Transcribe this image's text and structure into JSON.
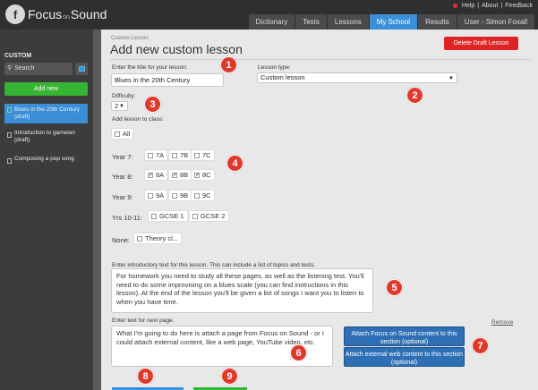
{
  "header": {
    "logo_mark": "f",
    "logo_name_left": "Focus",
    "logo_name_mid": "on",
    "logo_name_right": "Sound",
    "links": [
      "Help",
      "About",
      "Feedback"
    ],
    "tabs": [
      {
        "label": "Dictionary",
        "active": false
      },
      {
        "label": "Tests",
        "active": false
      },
      {
        "label": "Lessons",
        "active": false
      },
      {
        "label": "My School",
        "active": true
      },
      {
        "label": "Results",
        "active": false
      },
      {
        "label": "User - Simon Foxall",
        "active": false
      }
    ]
  },
  "sidebar": {
    "title": "CUSTOM",
    "search_label": "Search",
    "add_label": "Add new",
    "items": [
      {
        "label": "Blues in the 20th Century (draft)",
        "active": true
      },
      {
        "label": "Introduction to gamelan (draft)",
        "active": false
      },
      {
        "label": "Composing a pop song",
        "active": false
      }
    ]
  },
  "main": {
    "breadcrumb": "Custom Lesson",
    "title": "Add new custom lesson",
    "delete_label": "Delete Draft Lesson",
    "title_field_label": "Enter the title for your lesson:",
    "title_value": "Blues in the 20th Century",
    "lesson_type_label": "Lesson type:",
    "lesson_type_value": "Custom lesson",
    "difficulty_label": "Difficulty:",
    "difficulty_value": "2",
    "add_class_label": "Add lesson to class:",
    "all_label": "All",
    "year_rows": [
      {
        "label": "Year 7:",
        "classes": [
          {
            "name": "7A",
            "checked": false
          },
          {
            "name": "7B",
            "checked": false
          },
          {
            "name": "7C",
            "checked": false
          }
        ]
      },
      {
        "label": "Year 8:",
        "classes": [
          {
            "name": "8A",
            "checked": true
          },
          {
            "name": "8B",
            "checked": true
          },
          {
            "name": "8C",
            "checked": true
          }
        ]
      },
      {
        "label": "Year 9:",
        "classes": [
          {
            "name": "9A",
            "checked": false
          },
          {
            "name": "9B",
            "checked": false
          },
          {
            "name": "9C",
            "checked": false
          }
        ]
      },
      {
        "label": "Yrs 10-11:",
        "classes": [
          {
            "name": "GCSE 1",
            "checked": false
          },
          {
            "name": "GCSE 2",
            "checked": false
          }
        ]
      },
      {
        "label": "None:",
        "classes": [
          {
            "name": "Theory cl...",
            "checked": false
          }
        ]
      }
    ],
    "intro_label": "Enter introductory text for this lesson. This can include a list of topics and tests.",
    "intro_text": "For homework you need to study all these pages, as well as the listening test. You'll need to do some improvising on a blues scale (you can find instructions in this lesson). At the end of the lesson you'll be given a list of songs I want you to listen to when you have time.",
    "next_page_label": "Enter text for next page.",
    "remove_label": "Remove",
    "next_page_text": "What I'm going to do here is attach a page from Focus on Sound - or I could attach external content, like a web page, YouTube video, etc.",
    "attach_fos_label": "Attach Focus on Sound content to this section (optional)",
    "attach_web_label": "Attach external web content to this section (optional)",
    "badges": [
      "1",
      "2",
      "3",
      "4",
      "5",
      "6",
      "7",
      "8",
      "9"
    ]
  },
  "colors": {
    "accent_blue": "#3a8fd8",
    "add_green": "#36b534",
    "delete_red": "#e02424",
    "badge_red": "#e0392b"
  }
}
